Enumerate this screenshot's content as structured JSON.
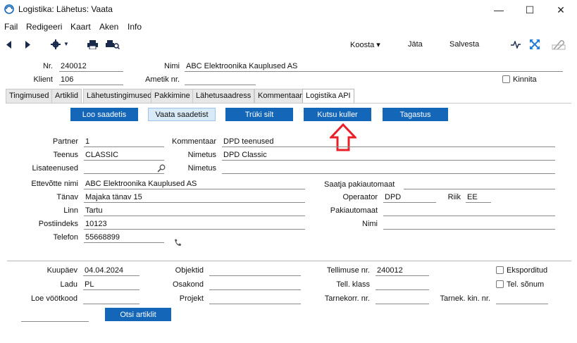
{
  "window": {
    "title": "Logistika: Lähetus: Vaata",
    "minimize": "—",
    "maximize": "☐",
    "close": "✕"
  },
  "menu": [
    "Fail",
    "Redigeeri",
    "Kaart",
    "Aken",
    "Info"
  ],
  "toolbar": {
    "koosta_label": "Koosta ▾",
    "jata_label": "Jäta",
    "salvesta_label": "Salvesta"
  },
  "header": {
    "nr_label": "Nr.",
    "nr_value": "240012",
    "nimi_label": "Nimi",
    "nimi_value": "ABC Elektroonika Kauplused AS",
    "klient_label": "Klient",
    "klient_value": "106",
    "ametik_label": "Ametik nr.",
    "ametik_value": "",
    "kinnita_label": "Kinnita"
  },
  "tabs": [
    "Tingimused",
    "Artiklid",
    "Lähetustingimused",
    "Pakkimine",
    "Lähetusaadress",
    "Kommentaar",
    "Logistika API"
  ],
  "actions": {
    "loo": "Loo saadetis",
    "vaata": "Vaata saadetist",
    "truki": "Trüki silt",
    "kutsu": "Kutsu kuller",
    "tagastus": "Tagastus"
  },
  "form": {
    "partner_label": "Partner",
    "partner_value": "1",
    "kommentaar_label": "Kommentaar",
    "kommentaar_value": "DPD teenused",
    "teenus_label": "Teenus",
    "teenus_value": "CLASSIC",
    "nimetus1_label": "Nimetus",
    "nimetus1_value": "DPD Classic",
    "lisateenused_label": "Lisateenused",
    "lisateenused_value": "",
    "nimetus2_label": "Nimetus",
    "nimetus2_value": "",
    "ettevotte_label": "Ettevõtte nimi",
    "ettevotte_value": "ABC Elektroonika Kauplused AS",
    "saatja_label": "Saatja pakiautomaat",
    "tanav_label": "Tänav",
    "tanav_value": "Majaka tänav 15",
    "operaator_label": "Operaator",
    "operaator_value": "DPD",
    "riik_label": "Riik",
    "riik_value": "EE",
    "linn_label": "Linn",
    "linn_value": "Tartu",
    "pakiautomaat_label": "Pakiautomaat",
    "pakiautomaat_value": "",
    "postiindeks_label": "Postiindeks",
    "postiindeks_value": "10123",
    "nimi_label": "Nimi",
    "nimi_value": "",
    "telefon_label": "Telefon",
    "telefon_value": "55668899"
  },
  "lower": {
    "kuupaev_label": "Kuupäev",
    "kuupaev_value": "04.04.2024",
    "objektid_label": "Objektid",
    "objektid_value": "",
    "tellimuse_label": "Tellimuse nr.",
    "tellimuse_value": "240012",
    "eksporditud_label": "Eksporditud",
    "ladu_label": "Ladu",
    "ladu_value": "PL",
    "osakond_label": "Osakond",
    "osakond_value": "",
    "tellklass_label": "Tell. klass",
    "tellklass_value": "",
    "telsonum_label": "Tel. sõnum",
    "loe_label": "Loe vöötkood",
    "loe_value": "",
    "projekt_label": "Projekt",
    "projekt_value": "",
    "tarnekorr_label": "Tarnekorr. nr.",
    "tarnekorr_value": "",
    "tarnekkin_label": "Tarnek. kin. nr.",
    "tarnekkin_value": "",
    "otsi_label": "Otsi artiklit"
  },
  "colors": {
    "button_blue": "#1466b8",
    "arrow_red": "#e8202a",
    "active_tab": "#ffffff"
  },
  "icons": [
    "app-icon",
    "back-arrow-icon",
    "forward-arrow-icon",
    "gear-icon",
    "printer-icon",
    "print-preview-icon",
    "activity-icon",
    "expand-icon",
    "attachment-icon",
    "search-icon",
    "phone-icon",
    "red-up-arrow-icon"
  ]
}
